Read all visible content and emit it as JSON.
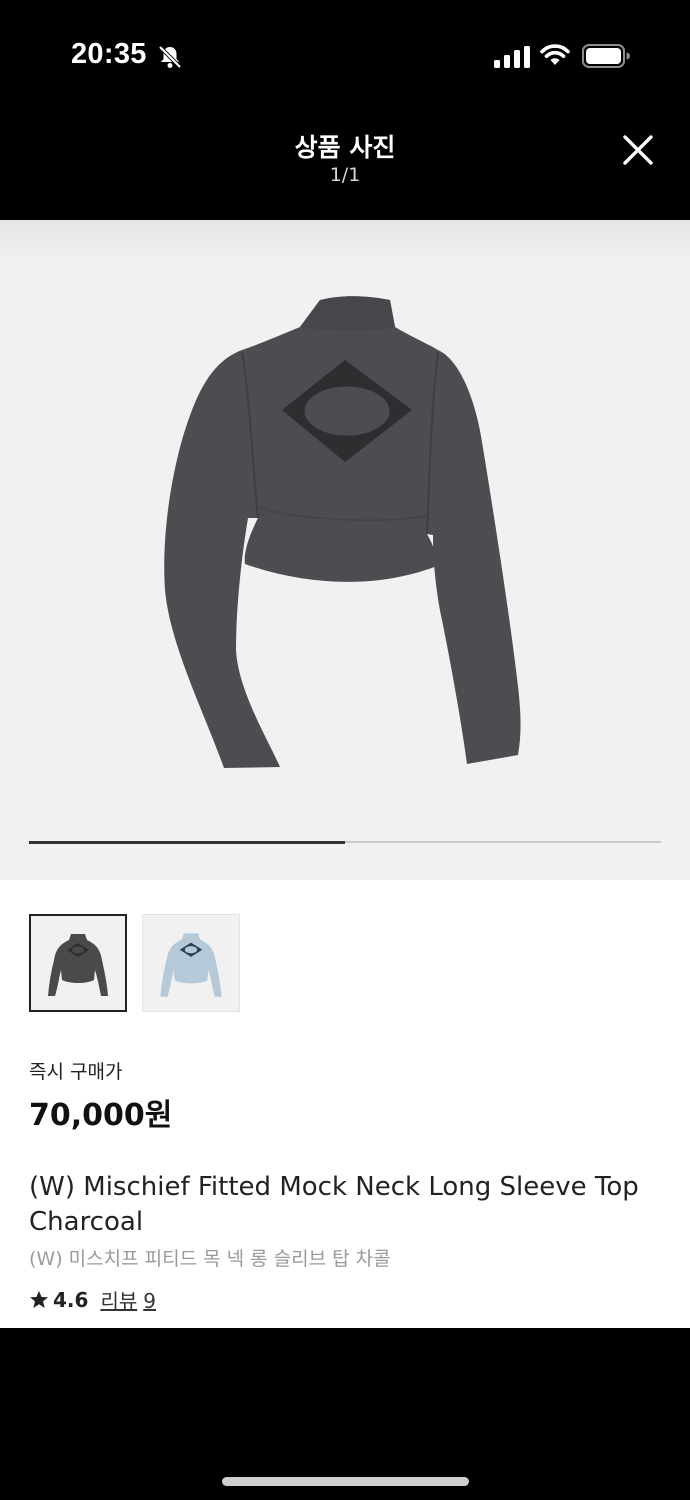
{
  "status_bar": {
    "time": "20:35"
  },
  "header": {
    "title": "상품 사진",
    "counter": "1/1"
  },
  "gallery": {
    "progress": 0.5
  },
  "product": {
    "thumbnails": [
      {
        "color_name": "charcoal",
        "color": "#4a4a4c",
        "selected": true
      },
      {
        "color_name": "light-blue",
        "color": "#b5c9d9",
        "selected": false
      }
    ],
    "price_label": "즉시 구매가",
    "price": "70,000원",
    "name": "(W) Mischief Fitted Mock Neck Long Sleeve Top Charcoal",
    "name_ko": "(W) 미스치프 피티드 목 넥 롱 슬리브 탑 차콜",
    "rating": "4.6",
    "review_label": "리뷰",
    "review_count": "9"
  },
  "icons": {
    "silent": "bell-slash-icon",
    "signal": "cellular-signal-icon",
    "wifi": "wifi-icon",
    "battery": "battery-icon",
    "close": "close-icon",
    "star": "star-icon"
  },
  "colors": {
    "garment": "#4d4c50",
    "garment_dark": "#3a393c",
    "logo_fill": "#2e2d30"
  }
}
